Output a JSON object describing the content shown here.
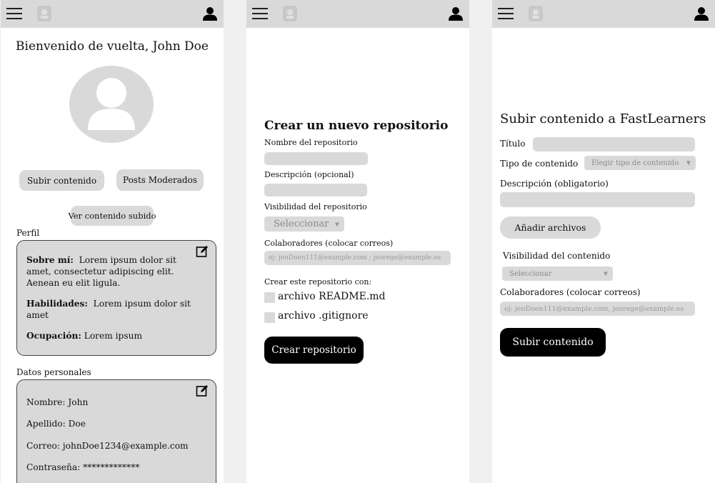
{
  "colors": {
    "topbar": "#d9d9d9",
    "field": "#d9d9d9",
    "primary_button": "#000000",
    "background": "#ffffff"
  },
  "icons": {
    "menu": "hamburger-icon",
    "logo": "logo-icon",
    "user": "user-icon",
    "avatar": "avatar-icon",
    "edit": "edit-icon"
  },
  "profile_screen": {
    "welcome": "Bienvenido de vuelta, John Doe",
    "upload_button": "Subir contenido",
    "moderated_button": "Posts Moderados",
    "view_uploaded_button": "Ver contenido subido",
    "perfil_title": "Perfil",
    "perfil": {
      "about_label": "Sobre mí:",
      "about_line1": "Lorem ipsum dolor sit",
      "about_line2": "amet, consectetur adipiscing elit.",
      "about_line3": "Aenean eu elit  ligula.",
      "skills_label": "Habilidades:",
      "skills_line1": "Lorem ipsum dolor sit",
      "skills_line2": "amet",
      "occupation_label": "Ocupación:",
      "occupation_value": "Lorem ipsum"
    },
    "personal_title": "Datos personales",
    "personal": {
      "name_label": "Nombre:",
      "name_value": "John",
      "surname_label": "Apellido:",
      "surname_value": "Doe",
      "email_label": "Correo:",
      "email_value": "johnDoe1234@example.com",
      "password_label": "Contraseña:",
      "password_value": "*************"
    }
  },
  "repo_screen": {
    "title": "Crear un nuevo repositorio",
    "name_label": "Nombre del repositorio",
    "desc_label": "Descripción (opcional)",
    "visibility_label": "Visibilidad del repositorio",
    "visibility_value": "Seleccionar",
    "collab_label": "Colaboradores (colocar correos)",
    "collab_placeholder": "ej: jenDoen111@example.com ; jeorege@example.es",
    "create_with_label": "Crear este repositorio con:",
    "readme_label": "archivo README.md",
    "gitignore_label": "archivo .gitignore",
    "create_button": "Crear repositorio"
  },
  "upload_screen": {
    "title": "Subir contenido a FastLearners",
    "title_label": "Título",
    "type_label": "Tipo de contenido",
    "type_placeholder": "Elegir tipo de contenido",
    "desc_label": "Descripción (obligatorio)",
    "add_files_button": "Añadir archivos",
    "visibility_label": "Visibilidad del contenido",
    "visibility_value": "Seleccionar",
    "collab_label": "Colaboradores (colocar correos)",
    "collab_placeholder": "ej: jenDoen111@example.com, jeorege@example.es",
    "submit_button": "Subir contenido"
  }
}
